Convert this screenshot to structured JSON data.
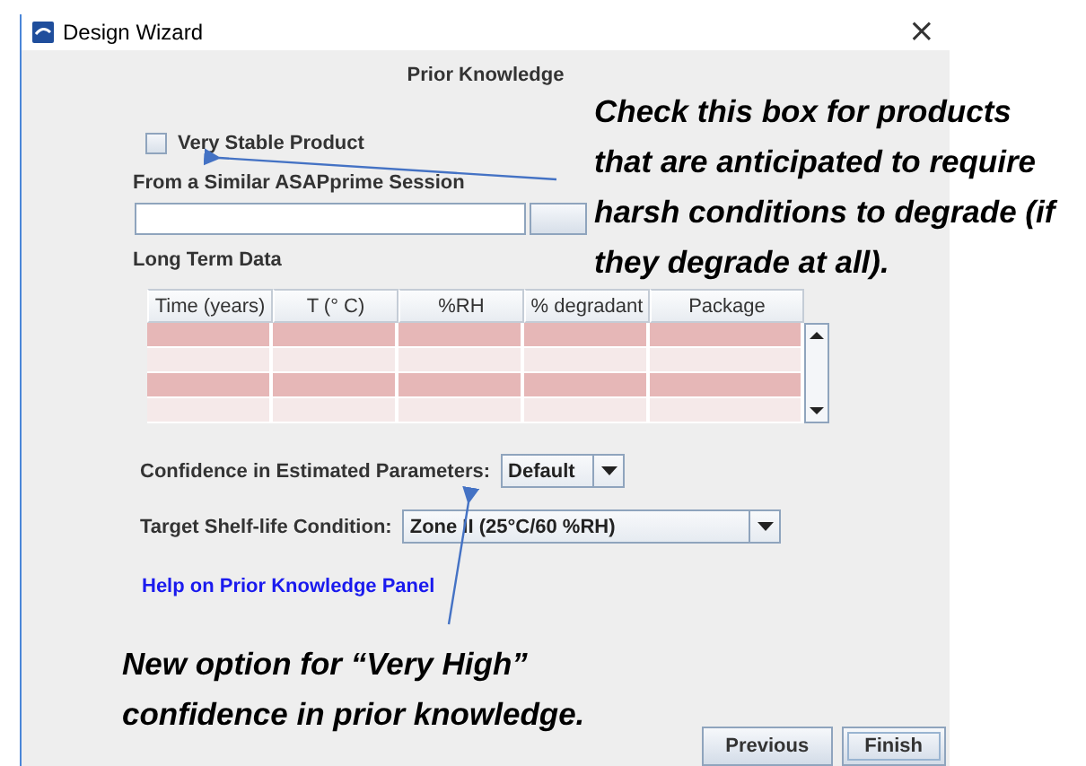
{
  "window": {
    "title": "Design Wizard",
    "close": "×"
  },
  "panel_title": "Prior Knowledge",
  "very_stable_product": {
    "label": "Very Stable Product",
    "checked": false
  },
  "similar_session": {
    "label": "From a Similar ASAPprime Session"
  },
  "long_term_data": {
    "label": "Long Term Data",
    "columns": [
      "Time (years)",
      "T (° C)",
      "%RH",
      "% degradant",
      "Package"
    ],
    "rows": [
      {
        "shaded": true
      },
      {
        "shaded": false
      },
      {
        "shaded": true
      },
      {
        "shaded": false
      }
    ]
  },
  "confidence": {
    "label": "Confidence in Estimated Parameters:",
    "value": "Default"
  },
  "target_condition": {
    "label": "Target Shelf-life Condition:",
    "value": "Zone II (25°C/60 %RH)"
  },
  "help_link": "Help on Prior Knowledge Panel",
  "buttons": [
    {
      "label": "Previous",
      "focused": false
    },
    {
      "label": "Finish",
      "focused": true
    }
  ],
  "callouts": [
    {
      "text": "Check this box for products that are anticipated to require harsh conditions to degrade (if they degrade at all)."
    },
    {
      "text": "New option for “Very High” confidence in prior knowledge."
    }
  ]
}
